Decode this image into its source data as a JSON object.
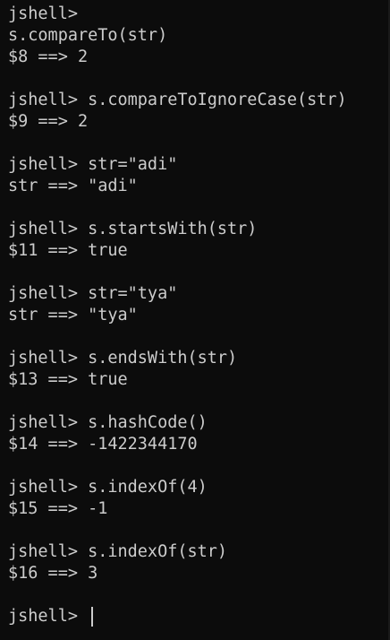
{
  "terminal": {
    "lines": [
      "jshell>",
      "s.compareTo(str)",
      "$8 ==> 2",
      "",
      "jshell> s.compareToIgnoreCase(str)",
      "$9 ==> 2",
      "",
      "jshell> str=\"adi\"",
      "str ==> \"adi\"",
      "",
      "jshell> s.startsWith(str)",
      "$11 ==> true",
      "",
      "jshell> str=\"tya\"",
      "str ==> \"tya\"",
      "",
      "jshell> s.endsWith(str)",
      "$13 ==> true",
      "",
      "jshell> s.hashCode()",
      "$14 ==> -1422344170",
      "",
      "jshell> s.indexOf(4)",
      "$15 ==> -1",
      "",
      "jshell> s.indexOf(str)",
      "$16 ==> 3",
      ""
    ],
    "prompt": "jshell> ",
    "input_value": ""
  },
  "colors": {
    "background": "#0c0c0c",
    "foreground": "#cccccc"
  }
}
